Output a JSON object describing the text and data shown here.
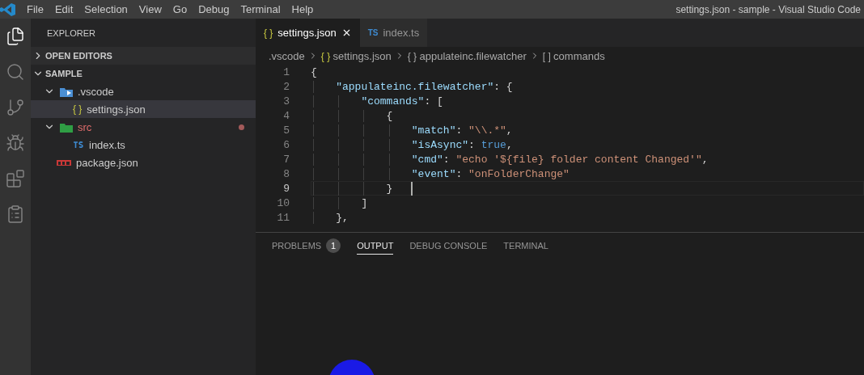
{
  "menu": [
    "File",
    "Edit",
    "Selection",
    "View",
    "Go",
    "Debug",
    "Terminal",
    "Help"
  ],
  "window": {
    "title": "settings.json - sample - Visual Studio Code"
  },
  "activity_bar": [
    {
      "kind": "files",
      "selected": true
    },
    {
      "kind": "search",
      "selected": false
    },
    {
      "kind": "git",
      "selected": false
    },
    {
      "kind": "debug",
      "selected": false
    },
    {
      "kind": "extensions",
      "selected": false
    },
    {
      "kind": "tasks",
      "selected": false
    }
  ],
  "sidebar": {
    "title": "EXPLORER",
    "sections": [
      {
        "label": "OPEN EDITORS",
        "expanded": false
      },
      {
        "label": "SAMPLE",
        "expanded": true
      }
    ],
    "tree": [
      {
        "label": ".vscode",
        "kind": "folder-vscode",
        "expanded": true,
        "selected": false,
        "has_problem": false,
        "children": [
          {
            "label": "settings.json",
            "kind": "json",
            "icon_text": "{ }",
            "selected": true,
            "has_problem": false
          }
        ]
      },
      {
        "label": "src",
        "kind": "folder-src",
        "expanded": true,
        "selected": false,
        "has_problem": true,
        "children": [
          {
            "label": "index.ts",
            "kind": "ts",
            "selected": false,
            "has_problem": false
          }
        ]
      },
      {
        "label": "package.json",
        "kind": "npm",
        "selected": false,
        "has_problem": false
      }
    ]
  },
  "tabs": [
    {
      "label": "settings.json",
      "kind": "json",
      "icon_text": "{ }",
      "selected": true
    },
    {
      "label": "index.ts",
      "kind": "ts",
      "icon_text": "TS",
      "selected": false
    }
  ],
  "breadcrumb": [
    {
      "label": ".vscode"
    },
    {
      "label": "settings.json",
      "icon_text": "{ }"
    },
    {
      "label": "appulateinc.filewatcher",
      "icon_text": "{ }"
    },
    {
      "label": "commands",
      "icon_text": "[ ]"
    }
  ],
  "lines": [
    {
      "number": "1",
      "current": false,
      "tokens": [
        {
          "kind": "punct",
          "text": "{"
        }
      ]
    },
    {
      "number": "2",
      "current": false,
      "tokens": [
        {
          "kind": "key",
          "text": "    \"appulateinc.filewatcher\""
        },
        {
          "kind": "punct",
          "text": ": {"
        }
      ]
    },
    {
      "number": "3",
      "current": false,
      "tokens": [
        {
          "kind": "key",
          "text": "        \"commands\""
        },
        {
          "kind": "punct",
          "text": ": ["
        }
      ]
    },
    {
      "number": "4",
      "current": false,
      "tokens": [
        {
          "kind": "punct",
          "text": "            {"
        }
      ]
    },
    {
      "number": "5",
      "current": false,
      "tokens": [
        {
          "kind": "key",
          "text": "                \"match\""
        },
        {
          "kind": "punct",
          "text": ": "
        },
        {
          "kind": "string",
          "text": "\"\\\\.*\""
        },
        {
          "kind": "punct",
          "text": ","
        }
      ]
    },
    {
      "number": "6",
      "current": false,
      "tokens": [
        {
          "kind": "key",
          "text": "                \"isAsync\""
        },
        {
          "kind": "punct",
          "text": ": "
        },
        {
          "kind": "bool",
          "text": "true"
        },
        {
          "kind": "punct",
          "text": ","
        }
      ]
    },
    {
      "number": "7",
      "current": false,
      "tokens": [
        {
          "kind": "key",
          "text": "                \"cmd\""
        },
        {
          "kind": "punct",
          "text": ": "
        },
        {
          "kind": "string",
          "text": "\"echo '${file} folder content Changed'\""
        },
        {
          "kind": "punct",
          "text": ","
        }
      ]
    },
    {
      "number": "8",
      "current": false,
      "tokens": [
        {
          "kind": "key",
          "text": "                \"event\""
        },
        {
          "kind": "punct",
          "text": ": "
        },
        {
          "kind": "string",
          "text": "\"onFolderChange\""
        }
      ]
    },
    {
      "number": "9",
      "current": true,
      "tokens": [
        {
          "kind": "punct",
          "text": "            }"
        }
      ]
    },
    {
      "number": "10",
      "current": false,
      "tokens": [
        {
          "kind": "punct",
          "text": "        ]"
        }
      ]
    },
    {
      "number": "11",
      "current": false,
      "tokens": [
        {
          "kind": "punct",
          "text": "    },"
        }
      ]
    }
  ],
  "panel": {
    "tabs": [
      {
        "label": "PROBLEMS",
        "badge": "1",
        "selected": false
      },
      {
        "label": "OUTPUT",
        "selected": true
      },
      {
        "label": "DEBUG CONSOLE",
        "selected": false
      },
      {
        "label": "TERMINAL",
        "selected": false
      }
    ]
  }
}
